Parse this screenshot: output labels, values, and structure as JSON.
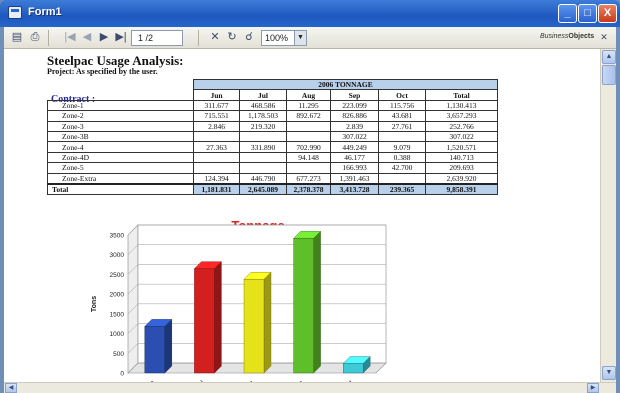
{
  "window": {
    "title": "Form1",
    "controls": [
      "_",
      "□",
      "X"
    ]
  },
  "toolbar": {
    "page_value": "1 /2",
    "zoom_value": "100%",
    "brand_prefix": "Business",
    "brand_suffix": "Objects"
  },
  "report": {
    "title": "Steelpac Usage Analysis:",
    "subtitle": "Project: As specified by the user.",
    "contract_label": "Contract :",
    "table": {
      "group_header": "2006 TONNAGE",
      "columns": [
        "Jun",
        "Jul",
        "Aug",
        "Sep",
        "Oct",
        "Total"
      ],
      "rows": [
        {
          "zone": "Zone-1",
          "values": [
            "311.677",
            "468.586",
            "11.295",
            "223.099",
            "115.756",
            "1,130.413"
          ]
        },
        {
          "zone": "Zone-2",
          "values": [
            "715.551",
            "1,178.503",
            "892.672",
            "826.886",
            "43.681",
            "3,657.293"
          ]
        },
        {
          "zone": "Zone-3",
          "values": [
            "2.846",
            "219.320",
            "",
            "2.839",
            "27.761",
            "252.766"
          ]
        },
        {
          "zone": "Zone-3B",
          "values": [
            "",
            "",
            "",
            "307.022",
            "",
            "307.022"
          ]
        },
        {
          "zone": "Zone-4",
          "values": [
            "27.363",
            "331.890",
            "702.990",
            "449.249",
            "9.079",
            "1,520.571"
          ]
        },
        {
          "zone": "Zone-4D",
          "values": [
            "",
            "",
            "94.148",
            "46.177",
            "0.388",
            "140.713"
          ]
        },
        {
          "zone": "Zone-5",
          "values": [
            "",
            "",
            "",
            "166.993",
            "42.700",
            "209.693"
          ]
        },
        {
          "zone": "Zone-Extra",
          "values": [
            "124.394",
            "446.790",
            "677.273",
            "1,391.463",
            "",
            "2,639.920"
          ]
        }
      ],
      "total_row": {
        "label": "Total",
        "values": [
          "1,181.831",
          "2,645.089",
          "2,378.378",
          "3,413.728",
          "239.365",
          "9,858.391"
        ]
      }
    }
  },
  "chart_data": {
    "type": "bar",
    "title": "Tonnage",
    "title_color": "#e02020",
    "ylabel": "Tons",
    "xlabel": "",
    "categories": [
      "Jun",
      "Jul",
      "Aug",
      "Sep",
      "Oct"
    ],
    "values": [
      1181.831,
      2645.089,
      2378.378,
      3413.728,
      239.365
    ],
    "colors": [
      "#2a4fb0",
      "#d41f1f",
      "#e5e21a",
      "#5fbf2a",
      "#3ec9d6"
    ],
    "ylim": [
      0,
      3500
    ],
    "yticks": [
      0,
      500,
      1000,
      1500,
      2000,
      2500,
      3000,
      3500
    ],
    "grid": true,
    "style": "3d"
  }
}
